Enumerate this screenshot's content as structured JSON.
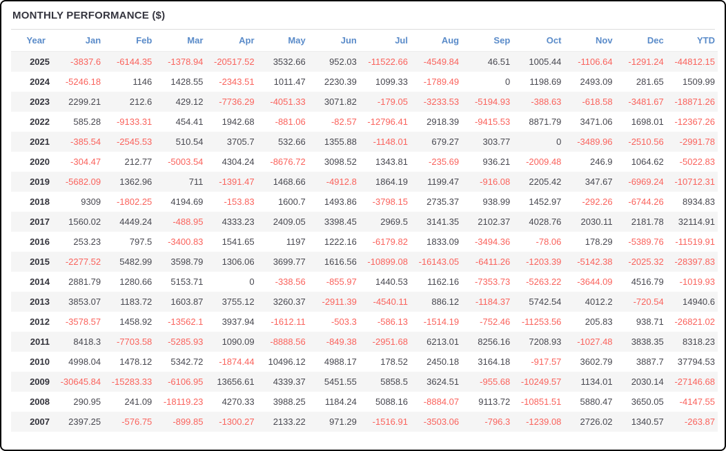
{
  "title": "MONTHLY PERFORMANCE ($)",
  "colors": {
    "negative": "#fa625c",
    "positive": "#47474f",
    "header_blue": "#5a8bc9",
    "year_text": "#33333b",
    "row_stripe": "#f5f5f5",
    "divider": "#dcdcdc"
  },
  "table": {
    "columns": [
      "Year",
      "Jan",
      "Feb",
      "Mar",
      "Apr",
      "May",
      "Jun",
      "Jul",
      "Aug",
      "Sep",
      "Oct",
      "Nov",
      "Dec",
      "YTD"
    ],
    "rows": [
      {
        "year": "2025",
        "values": [
          "-3837.6",
          "-6144.35",
          "-1378.94",
          "-20517.52",
          "3532.66",
          "952.03",
          "-11522.66",
          "-4549.84",
          "46.51",
          "1005.44",
          "-1106.64",
          "-1291.24",
          "-44812.15"
        ]
      },
      {
        "year": "2024",
        "values": [
          "-5246.18",
          "1146",
          "1428.55",
          "-2343.51",
          "1011.47",
          "2230.39",
          "1099.33",
          "-1789.49",
          "0",
          "1198.69",
          "2493.09",
          "281.65",
          "1509.99"
        ]
      },
      {
        "year": "2023",
        "values": [
          "2299.21",
          "212.6",
          "429.12",
          "-7736.29",
          "-4051.33",
          "3071.82",
          "-179.05",
          "-3233.53",
          "-5194.93",
          "-388.63",
          "-618.58",
          "-3481.67",
          "-18871.26"
        ]
      },
      {
        "year": "2022",
        "values": [
          "585.28",
          "-9133.31",
          "454.41",
          "1942.68",
          "-881.06",
          "-82.57",
          "-12796.41",
          "2918.39",
          "-9415.53",
          "8871.79",
          "3471.06",
          "1698.01",
          "-12367.26"
        ]
      },
      {
        "year": "2021",
        "values": [
          "-385.54",
          "-2545.53",
          "510.54",
          "3705.7",
          "532.66",
          "1355.88",
          "-1148.01",
          "679.27",
          "303.77",
          "0",
          "-3489.96",
          "-2510.56",
          "-2991.78"
        ]
      },
      {
        "year": "2020",
        "values": [
          "-304.47",
          "212.77",
          "-5003.54",
          "4304.24",
          "-8676.72",
          "3098.52",
          "1343.81",
          "-235.69",
          "936.21",
          "-2009.48",
          "246.9",
          "1064.62",
          "-5022.83"
        ]
      },
      {
        "year": "2019",
        "values": [
          "-5682.09",
          "1362.96",
          "711",
          "-1391.47",
          "1468.66",
          "-4912.8",
          "1864.19",
          "1199.47",
          "-916.08",
          "2205.42",
          "347.67",
          "-6969.24",
          "-10712.31"
        ]
      },
      {
        "year": "2018",
        "values": [
          "9309",
          "-1802.25",
          "4194.69",
          "-153.83",
          "1600.7",
          "1493.86",
          "-3798.15",
          "2735.37",
          "938.99",
          "1452.97",
          "-292.26",
          "-6744.26",
          "8934.83"
        ]
      },
      {
        "year": "2017",
        "values": [
          "1560.02",
          "4449.24",
          "-488.95",
          "4333.23",
          "2409.05",
          "3398.45",
          "2969.5",
          "3141.35",
          "2102.37",
          "4028.76",
          "2030.11",
          "2181.78",
          "32114.91"
        ]
      },
      {
        "year": "2016",
        "values": [
          "253.23",
          "797.5",
          "-3400.83",
          "1541.65",
          "1197",
          "1222.16",
          "-6179.82",
          "1833.09",
          "-3494.36",
          "-78.06",
          "178.29",
          "-5389.76",
          "-11519.91"
        ]
      },
      {
        "year": "2015",
        "values": [
          "-2277.52",
          "5482.99",
          "3598.79",
          "1306.06",
          "3699.77",
          "1616.56",
          "-10899.08",
          "-16143.05",
          "-6411.26",
          "-1203.39",
          "-5142.38",
          "-2025.32",
          "-28397.83"
        ]
      },
      {
        "year": "2014",
        "values": [
          "2881.79",
          "1280.66",
          "5153.71",
          "0",
          "-338.56",
          "-855.97",
          "1440.53",
          "1162.16",
          "-7353.73",
          "-5263.22",
          "-3644.09",
          "4516.79",
          "-1019.93"
        ]
      },
      {
        "year": "2013",
        "values": [
          "3853.07",
          "1183.72",
          "1603.87",
          "3755.12",
          "3260.37",
          "-2911.39",
          "-4540.11",
          "886.12",
          "-1184.37",
          "5742.54",
          "4012.2",
          "-720.54",
          "14940.6"
        ]
      },
      {
        "year": "2012",
        "values": [
          "-3578.57",
          "1458.92",
          "-13562.1",
          "3937.94",
          "-1612.11",
          "-503.3",
          "-586.13",
          "-1514.19",
          "-752.46",
          "-11253.56",
          "205.83",
          "938.71",
          "-26821.02"
        ]
      },
      {
        "year": "2011",
        "values": [
          "8418.3",
          "-7703.58",
          "-5285.93",
          "1090.09",
          "-8888.56",
          "-849.38",
          "-2951.68",
          "6213.01",
          "8256.16",
          "7208.93",
          "-1027.48",
          "3838.35",
          "8318.23"
        ]
      },
      {
        "year": "2010",
        "values": [
          "4998.04",
          "1478.12",
          "5342.72",
          "-1874.44",
          "10496.12",
          "4988.17",
          "178.52",
          "2450.18",
          "3164.18",
          "-917.57",
          "3602.79",
          "3887.7",
          "37794.53"
        ]
      },
      {
        "year": "2009",
        "values": [
          "-30645.84",
          "-15283.33",
          "-6106.95",
          "13656.61",
          "4339.37",
          "5451.55",
          "5858.5",
          "3624.51",
          "-955.68",
          "-10249.57",
          "1134.01",
          "2030.14",
          "-27146.68"
        ]
      },
      {
        "year": "2008",
        "values": [
          "290.95",
          "241.09",
          "-18119.23",
          "4270.33",
          "3988.25",
          "1184.24",
          "5088.16",
          "-8884.07",
          "9113.72",
          "-10851.51",
          "5880.47",
          "3650.05",
          "-4147.55"
        ]
      },
      {
        "year": "2007",
        "values": [
          "2397.25",
          "-576.75",
          "-899.85",
          "-1300.27",
          "2133.22",
          "971.29",
          "-1516.91",
          "-3503.06",
          "-796.3",
          "-1239.08",
          "2726.02",
          "1340.57",
          "-263.87"
        ]
      }
    ]
  }
}
